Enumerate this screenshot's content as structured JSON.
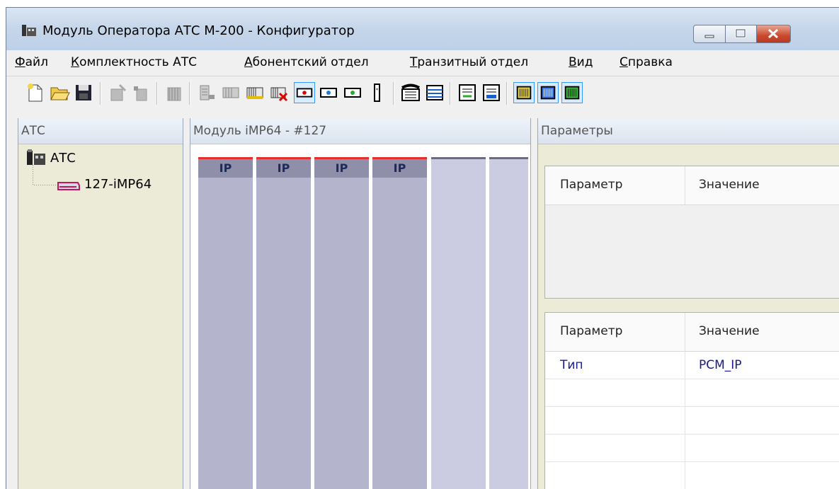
{
  "window": {
    "title": "Модуль Оператора АТС М-200 - Конфигуратор"
  },
  "menu": [
    {
      "hotkey": "Ф",
      "rest": "айл"
    },
    {
      "hotkey": "К",
      "rest": "омплектность АТС"
    },
    {
      "hotkey": "А",
      "rest": "бонентский отдел"
    },
    {
      "hotkey": "Т",
      "rest": "ранзитный отдел"
    },
    {
      "hotkey": "В",
      "rest": "ид"
    },
    {
      "hotkey": "С",
      "rest": "правка"
    }
  ],
  "toolbar": {
    "icons": [
      "new-icon",
      "open-icon",
      "save-icon",
      "add-station-icon",
      "remove-station-icon",
      "add-module-icon",
      "add-board-icon",
      "remove-board-icon",
      "edit-board-icon",
      "delete-board-icon",
      "port-red-icon",
      "port-blue-icon",
      "port-green-icon",
      "port-vertical-icon",
      "phone-icon",
      "list-icon",
      "import-icon",
      "export-icon",
      "view-yellow-icon",
      "view-blue-icon",
      "view-green-icon"
    ]
  },
  "tree": {
    "header": "АТС",
    "root": "АТС",
    "child": "127-iMP64"
  },
  "module": {
    "header": "Модуль iMP64 - #127",
    "slots": [
      {
        "label": "IP",
        "active": true
      },
      {
        "label": "IP",
        "active": true
      },
      {
        "label": "IP",
        "active": true
      },
      {
        "label": "IP",
        "active": true
      },
      {
        "label": "",
        "active": false
      },
      {
        "label": "",
        "active": false
      }
    ],
    "colors": {
      "active_slot": "#b4b4cc",
      "empty_slot": "#cbcbe1",
      "active_cap": "#e03030",
      "empty_cap": "#6c6c80"
    }
  },
  "params": {
    "header": "Параметры",
    "top_grid": {
      "col1": "Параметр",
      "col2": "Значение"
    },
    "bottom_grid": {
      "col1": "Параметр",
      "col2": "Значение",
      "rows": [
        {
          "name": "Тип",
          "value": "PCM_IP"
        }
      ]
    }
  }
}
